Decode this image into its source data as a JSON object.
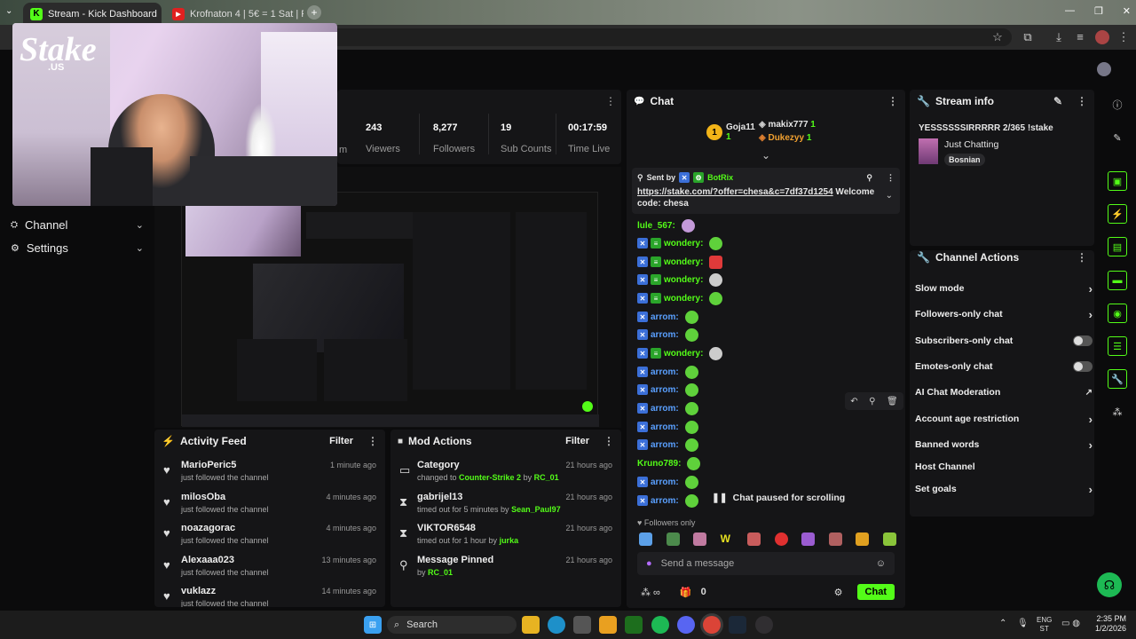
{
  "browser": {
    "tabs": [
      {
        "label": "Stream - Kick Dashboard",
        "favicon": "K"
      },
      {
        "label": "Krofnaton 4 | 5€ = 1 Sat | Po",
        "favicon": "▶"
      }
    ]
  },
  "webcam": {
    "brand": "Stake",
    "brand_sub": ".US"
  },
  "sidebar": {
    "items": [
      {
        "label": "Channel"
      },
      {
        "label": "Settings"
      }
    ]
  },
  "stats": [
    {
      "value": "243",
      "label": "Viewers"
    },
    {
      "value": "8,277",
      "label": "Followers"
    },
    {
      "value": "19",
      "label": "Sub Counts"
    },
    {
      "value": "00:17:59",
      "label": "Time Live"
    }
  ],
  "stats_partial_label": "m",
  "activity_feed": {
    "title": "Activity Feed",
    "filter": "Filter",
    "items": [
      {
        "name": "MarioPeric5",
        "desc": "just followed the channel",
        "time": "1 minute ago"
      },
      {
        "name": "milosOba",
        "desc": "just followed the channel",
        "time": "4 minutes ago"
      },
      {
        "name": "noazagorac",
        "desc": "just followed the channel",
        "time": "4 minutes ago"
      },
      {
        "name": "Alexaaa023",
        "desc": "just followed the channel",
        "time": "13 minutes ago"
      },
      {
        "name": "vuklazz",
        "desc": "just followed the channel",
        "time": "14 minutes ago"
      }
    ]
  },
  "mod_actions": {
    "title": "Mod Actions",
    "filter": "Filter",
    "items": [
      {
        "title": "Category",
        "pre": "changed to ",
        "hl": "Counter-Strike 2",
        "mid": " by ",
        "by": "RC_01",
        "time": "21 hours ago"
      },
      {
        "title": "gabrijel13",
        "pre": "timed out for 5 minutes by ",
        "hl": "",
        "mid": "",
        "by": "Sean_Paul97",
        "time": "21 hours ago"
      },
      {
        "title": "VIKTOR6548",
        "pre": "timed out for 1 hour by ",
        "hl": "",
        "mid": "",
        "by": "jurka",
        "time": "21 hours ago"
      },
      {
        "title": "Message Pinned",
        "pre": "by ",
        "hl": "",
        "mid": "",
        "by": "RC_01",
        "time": "21 hours ago"
      }
    ]
  },
  "chat": {
    "title": "Chat",
    "leaders": [
      {
        "rank": "1",
        "name": "Goja11",
        "count": "1"
      },
      {
        "name": "makix777",
        "count": "1"
      },
      {
        "name": "Dukezyy",
        "count": "1"
      }
    ],
    "pinned": {
      "sent_by_label": "Sent by",
      "sender": "BotRix",
      "link": "https://stake.com/?offer=chesa&c=7df37d1254",
      "text": " Welcome code: chesa"
    },
    "messages": [
      {
        "user": "lule_567:"
      },
      {
        "user": "wondery:"
      },
      {
        "user": "wondery:"
      },
      {
        "user": "wondery:"
      },
      {
        "user": "wondery:"
      },
      {
        "user": "arrom:"
      },
      {
        "user": "arrom:"
      },
      {
        "user": "wondery:"
      },
      {
        "user": "arrom:"
      },
      {
        "user": "arrom:"
      },
      {
        "user": "arrom:"
      },
      {
        "user": "arrom:"
      },
      {
        "user": "arrom:"
      },
      {
        "user": "Kruno789:"
      },
      {
        "user": "arrom:"
      },
      {
        "user": "arrom:"
      }
    ],
    "paused": "Chat paused for scrolling",
    "followers_only": "Followers only",
    "emote_w": "W",
    "input_placeholder": "Send a message",
    "bottom_count": "0",
    "send_label": "Chat"
  },
  "stream_info": {
    "title_label": "Stream info",
    "stream_title": "YESSSSSSIRRRRR 2/365 !stake",
    "category": "Just Chatting",
    "tag": "Bosnian"
  },
  "channel_actions": {
    "title": "Channel Actions",
    "items": [
      {
        "label": "Slow mode",
        "control": "chevron"
      },
      {
        "label": "Followers-only chat",
        "control": "chevron"
      },
      {
        "label": "Subscribers-only chat",
        "control": "toggle"
      },
      {
        "label": "Emotes-only chat",
        "control": "toggle"
      },
      {
        "label": "AI Chat Moderation",
        "control": "external"
      },
      {
        "label": "Account age restriction",
        "control": "chevron"
      },
      {
        "label": "Banned words",
        "control": "chevron"
      },
      {
        "label": "Host Channel",
        "control": "none"
      },
      {
        "label": "Set goals",
        "control": "chevron"
      }
    ]
  },
  "taskbar": {
    "search": "Search",
    "lang": "ENG",
    "lang2": "ST",
    "time": "2:35 PM",
    "date": "1/2/2026"
  },
  "colors": {
    "accent": "#53fc18",
    "panel": "#151517",
    "bg": "#0b0b0c",
    "link": "#5aa0ff"
  }
}
